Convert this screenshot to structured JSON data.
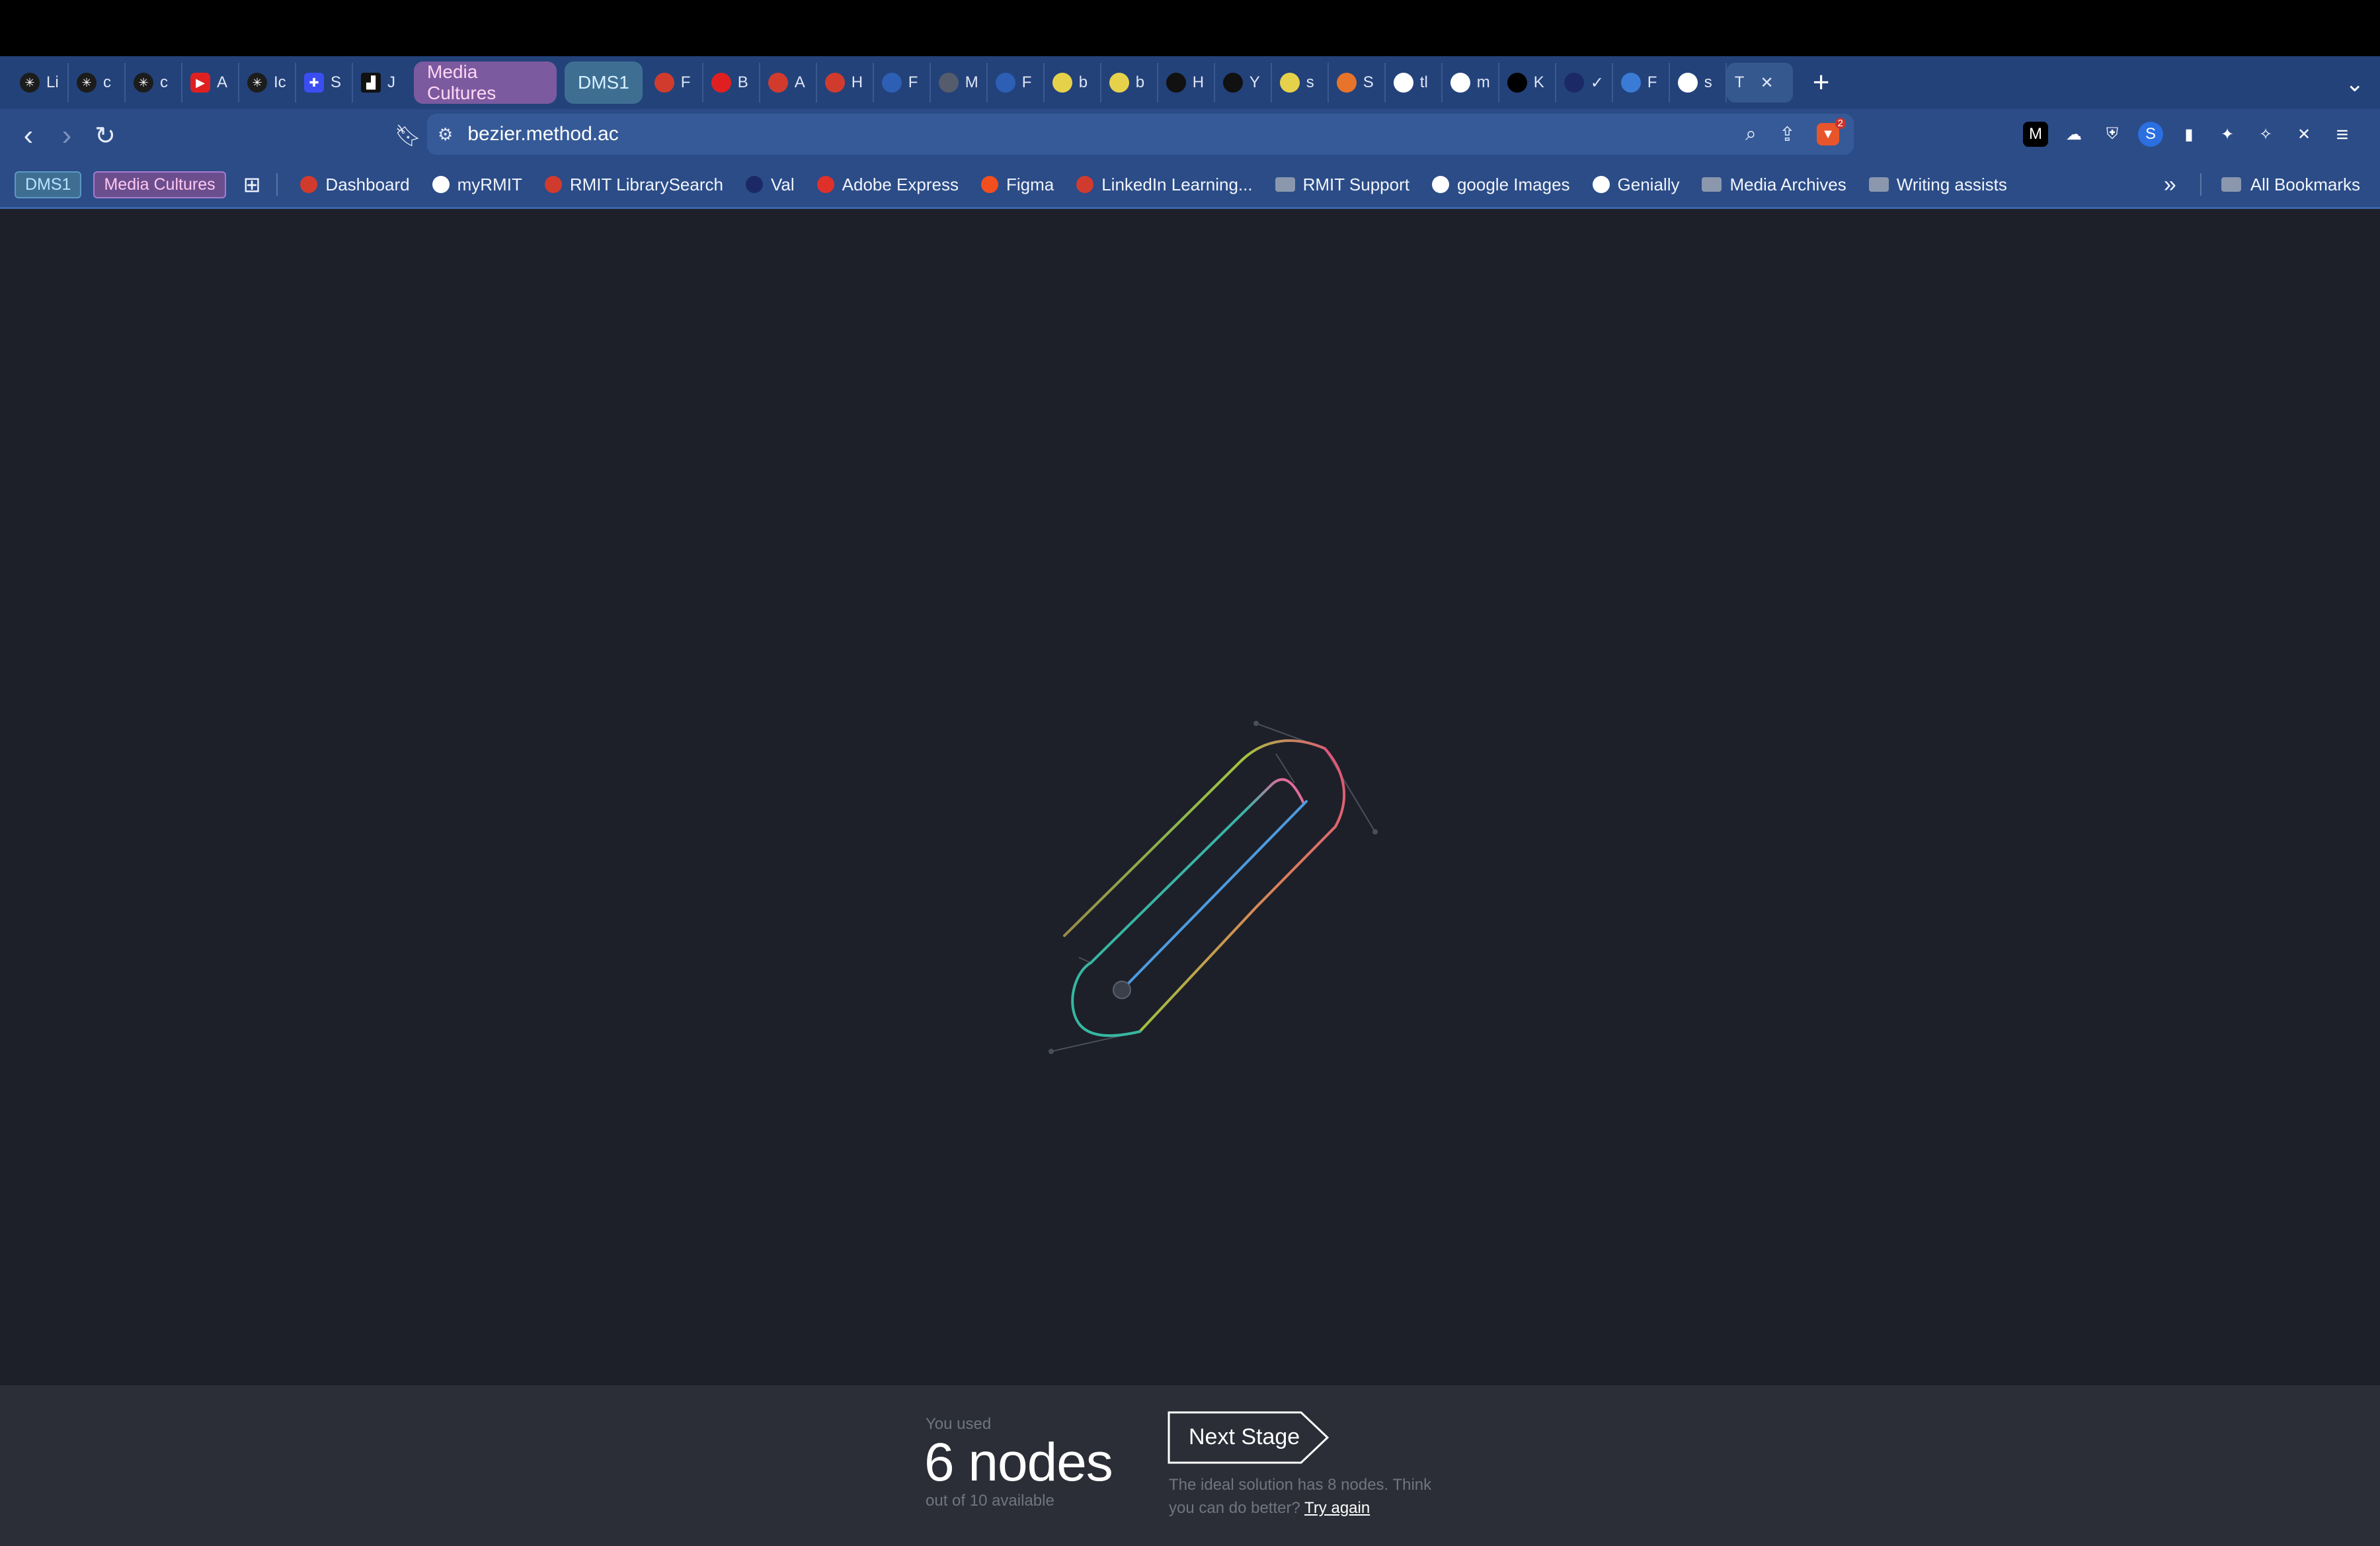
{
  "tabs": [
    {
      "label": "Li",
      "icon": "spark-icon",
      "color": "#1c1c1c"
    },
    {
      "label": "c",
      "icon": "spark-icon",
      "color": "#1c1c1c"
    },
    {
      "label": "c",
      "icon": "spark-icon",
      "color": "#1c1c1c"
    },
    {
      "label": "A",
      "icon": "youtube-icon",
      "color": "#e02020"
    },
    {
      "label": "Ic",
      "icon": "spark-icon",
      "color": "#1c1c1c"
    },
    {
      "label": "S",
      "icon": "app-icon",
      "color": "#3b4ef2"
    },
    {
      "label": "J",
      "icon": "app-icon",
      "color": "#111111"
    }
  ],
  "tab_groups": {
    "media": "Media Cultures",
    "dms1": "DMS1"
  },
  "tabs_after": [
    {
      "label": "F",
      "color": "#d13b2e"
    },
    {
      "label": "B",
      "color": "#e02020"
    },
    {
      "label": "A",
      "color": "#d13b2e"
    },
    {
      "label": "H",
      "color": "#d13b2e"
    },
    {
      "label": "F",
      "color": "#2d5fb5"
    },
    {
      "label": "M",
      "color": "#555c6b"
    },
    {
      "label": "F",
      "color": "#2d5fb5"
    },
    {
      "label": "b",
      "color": "#e6d24a"
    },
    {
      "label": "b",
      "color": "#e6d24a"
    },
    {
      "label": "H",
      "color": "#111111"
    },
    {
      "label": "Y",
      "color": "#111111"
    },
    {
      "label": "s",
      "color": "#e6d24a"
    },
    {
      "label": "S",
      "color": "#e8732b"
    },
    {
      "label": "tl",
      "color": "#ffffff"
    },
    {
      "label": "m",
      "color": "#ffffff"
    },
    {
      "label": "K",
      "color": "#000000"
    },
    {
      "label": "✓",
      "color": "#1b2a66"
    },
    {
      "label": "F",
      "color": "#3a7bd5"
    },
    {
      "label": "s",
      "color": "#ffffff"
    }
  ],
  "active_tab": {
    "label": "T",
    "close": "✕"
  },
  "new_tab": "+",
  "tab_menu": "⌄",
  "address": {
    "url": "bezier.method.ac",
    "brave_badge": "2"
  },
  "bookmarks": {
    "chips": [
      {
        "label": "DMS1",
        "color": "#7ec9ff"
      },
      {
        "label": "Media Cultures",
        "color": "#ff9ce3"
      }
    ],
    "items": [
      {
        "label": "Dashboard",
        "icon_color": "#d13b2e"
      },
      {
        "label": "myRMIT",
        "icon_color": "#ffffff"
      },
      {
        "label": "RMIT LibrarySearch",
        "icon_color": "#d13b2e"
      },
      {
        "label": "Val",
        "icon_color": "#1b2a66"
      },
      {
        "label": "Adobe Express",
        "icon_color": "#e0302a"
      },
      {
        "label": "Figma",
        "icon_color": "#f24e1e"
      },
      {
        "label": "LinkedIn Learning...",
        "icon_color": "#d13b2e"
      }
    ],
    "folders": [
      {
        "label": "RMIT Support",
        "type": "folder"
      },
      {
        "label": "google Images",
        "type": "google"
      },
      {
        "label": "Genially",
        "type": "genially"
      },
      {
        "label": "Media Archives",
        "type": "folder"
      },
      {
        "label": "Writing assists",
        "type": "folder"
      }
    ],
    "overflow": "»",
    "all": "All Bookmarks"
  },
  "result": {
    "used_label": "You used",
    "nodes": "6 nodes",
    "out_of": "out of 10 available",
    "next_stage": "Next Stage",
    "ideal_text": "The ideal solution has 8 nodes. Think you can do better?",
    "try_again": "Try again"
  },
  "colors": {
    "canvas_bg": "#1d2029",
    "panel_bg": "#2b2e36",
    "toolbar_bg": "#2b4c87",
    "tabstrip_bg": "#23427a"
  }
}
